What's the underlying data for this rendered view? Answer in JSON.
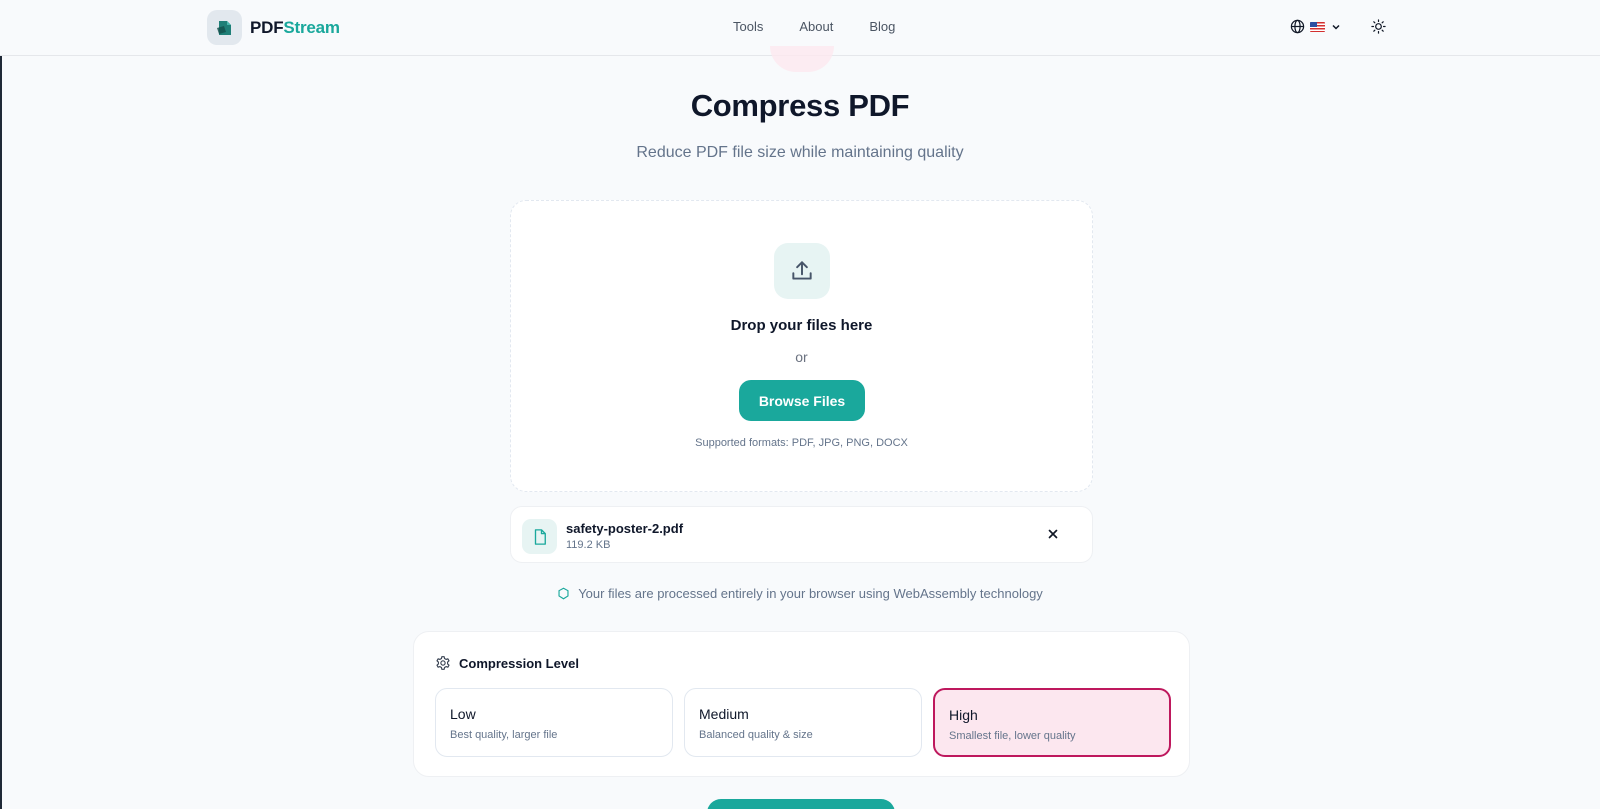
{
  "header": {
    "brand_part1": "PDF",
    "brand_part2": "Stream",
    "nav": [
      "Tools",
      "About",
      "Blog"
    ],
    "language_flag": "us-flag-icon"
  },
  "page": {
    "title": "Compress PDF",
    "subtitle": "Reduce PDF file size while maintaining quality"
  },
  "dropzone": {
    "title": "Drop your files here",
    "or": "or",
    "browse_label": "Browse Files",
    "formats": "Supported formats: PDF, JPG, PNG, DOCX"
  },
  "file": {
    "name": "safety-poster-2.pdf",
    "size": "119.2 KB"
  },
  "security_note": "Your files are processed entirely in your browser using WebAssembly technology",
  "compression": {
    "heading": "Compression Level",
    "options": [
      {
        "label": "Low",
        "desc": "Best quality, larger file",
        "selected": false
      },
      {
        "label": "Medium",
        "desc": "Balanced quality & size",
        "selected": false
      },
      {
        "label": "High",
        "desc": "Smallest file, lower quality",
        "selected": true
      }
    ]
  },
  "colors": {
    "accent": "#1aa89c",
    "selected_border": "#be185d",
    "selected_bg": "#fce7ef",
    "background": "#f8fafc"
  }
}
